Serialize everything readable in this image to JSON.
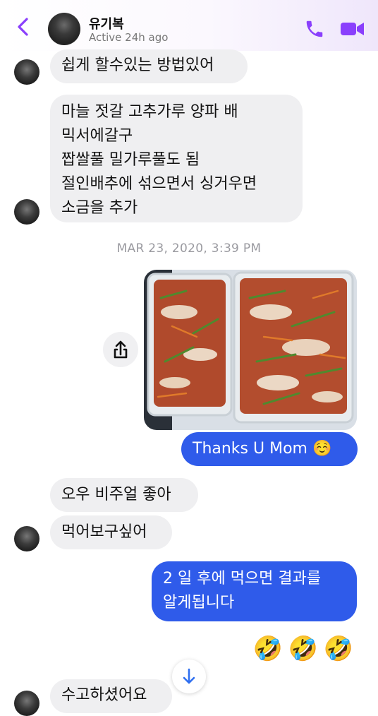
{
  "header": {
    "contact_name": "유기복",
    "status": "Active 24h ago"
  },
  "messages": {
    "m1": "쉽게 할수있는 방법있어",
    "m2_lines": [
      "마늘 젓갈 고추가루 양파 배",
      "믹서에갈구",
      "짭쌀풀 밀가루풀도 됨",
      "절인배추에 섞으면서 싱거우면",
      "소금을 추가"
    ],
    "timestamp": "MAR 23, 2020, 3:39 PM",
    "m_out1": "Thanks U Mom ☺️",
    "m3": "오우 비주얼 좋아",
    "m4": "먹어보구싶어",
    "m_out2_lines": [
      "2 일 후에 먹으면 결과를",
      "알게됩니다"
    ],
    "emojis": [
      "🤣",
      "🤣",
      "🤣"
    ],
    "m5": "수고하셨어요"
  },
  "colors": {
    "accent": "#8a3ffc",
    "outgoing_bubble": "#2f5bea",
    "incoming_bubble": "#efeff1"
  },
  "icons": {
    "back": "chevron-left-icon",
    "call": "phone-icon",
    "video": "video-camera-icon",
    "share": "share-icon",
    "scroll": "arrow-down-icon"
  }
}
